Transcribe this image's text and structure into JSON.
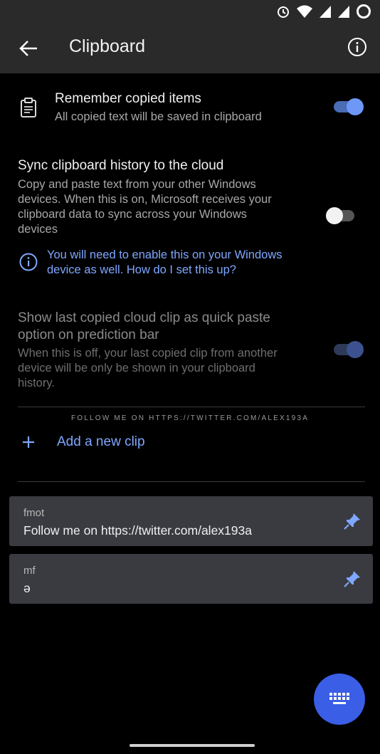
{
  "app": {
    "title": "Clipboard"
  },
  "settings": {
    "remember": {
      "title": "Remember copied items",
      "subtitle": "All copied text will be saved in clipboard",
      "enabled": true
    },
    "sync": {
      "title": "Sync clipboard history to the cloud",
      "subtitle_lines": [
        "Copy and paste text from your other Windows",
        "devices. When this is on, Microsoft receives your",
        "clipboard data to sync across your Windows",
        "devices"
      ],
      "enabled": false,
      "info_lines": [
        "You will need to enable this on your Windows",
        "device as well. How do I set this up?"
      ]
    },
    "quick_paste": {
      "title_lines": [
        "Show last copied cloud clip as quick paste",
        "option on prediction bar"
      ],
      "subtitle_lines": [
        "When this is off, your last copied clip from another",
        "device will be only be shown in your clipboard",
        "history."
      ],
      "enabled": true
    }
  },
  "follow_text": "FOLLOW ME ON HTTPS://TWITTER.COM/ALEX193A",
  "add_clip_label": "Add a new clip",
  "clips": [
    {
      "title": "fmot",
      "text": "Follow me on https://twitter.com/alex193a"
    },
    {
      "title": "mf",
      "text": "ə"
    }
  ],
  "colors": {
    "accent": "#7fa7ff",
    "fab": "#3a5ee6",
    "toggle_on": "#6e97f8",
    "surface": "#3a3b40"
  }
}
